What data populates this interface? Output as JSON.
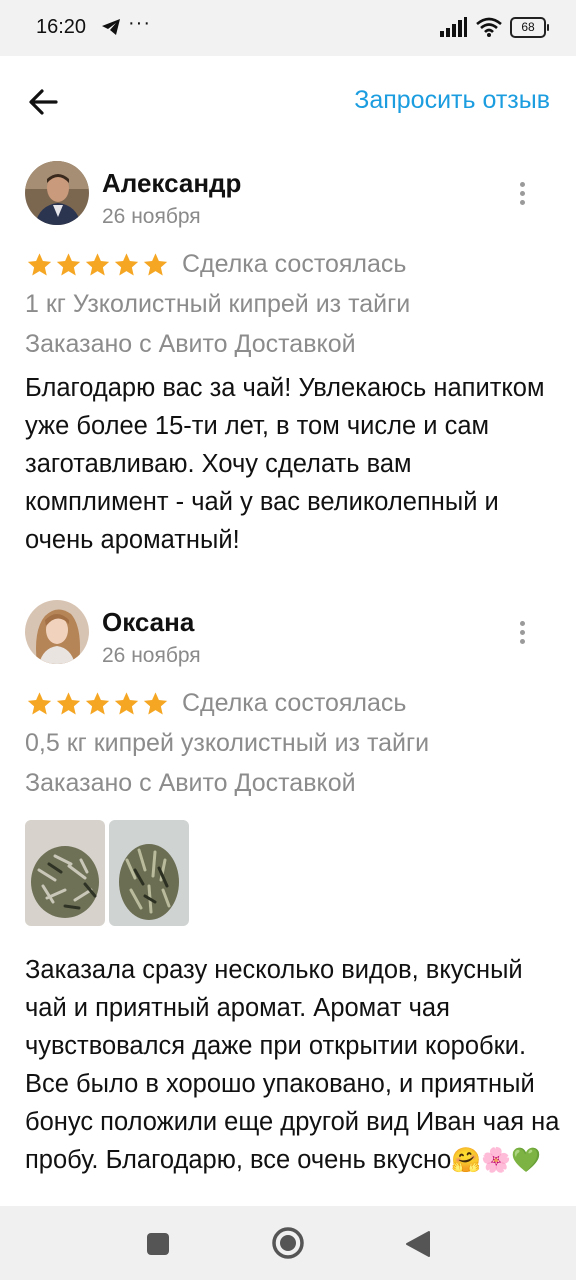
{
  "status_bar": {
    "time": "16:20",
    "telegram_icon": "telegram-icon",
    "more": "···",
    "battery": "68"
  },
  "header": {
    "back_icon": "arrow-left-icon",
    "request_review": "Запросить отзыв"
  },
  "colors": {
    "accent": "#1b9de0",
    "star": "#f5a623",
    "secondary_text": "#8c8c8c"
  },
  "reviews": [
    {
      "author": "Александр",
      "date": "26 ноября",
      "rating": 5,
      "deal_status": "Сделка состоялась",
      "item": "1 кг Узколистный кипрей из тайги",
      "delivery": "Заказано с Авито Доставкой",
      "text": "Благодарю вас за чай! Увлекаюсь напитком уже более 15-ти лет, в том числе и сам заготавливаю. Хочу сделать вам комплимент - чай у вас великолепный и очень ароматный!"
    },
    {
      "author": "Оксана",
      "date": "26 ноября",
      "rating": 5,
      "deal_status": "Сделка состоялась",
      "item": "0,5 кг кипрей узколистный из тайги",
      "delivery": "Заказано с Авито Доставкой",
      "photos": [
        "tea-photo-1",
        "tea-photo-2"
      ],
      "text": "Заказала сразу несколько видов, вкусный чай и приятный аромат. Аромат чая чувствовался даже при открытии коробки. Все было в хорошо упаковано, и приятный бонус положили еще другой вид Иван чая на пробу. Благодарю, все очень вкусно",
      "emojis": "🤗🌸💚"
    }
  ],
  "nav": {
    "recents": "square-icon",
    "home": "circle-icon",
    "back": "triangle-back-icon"
  }
}
